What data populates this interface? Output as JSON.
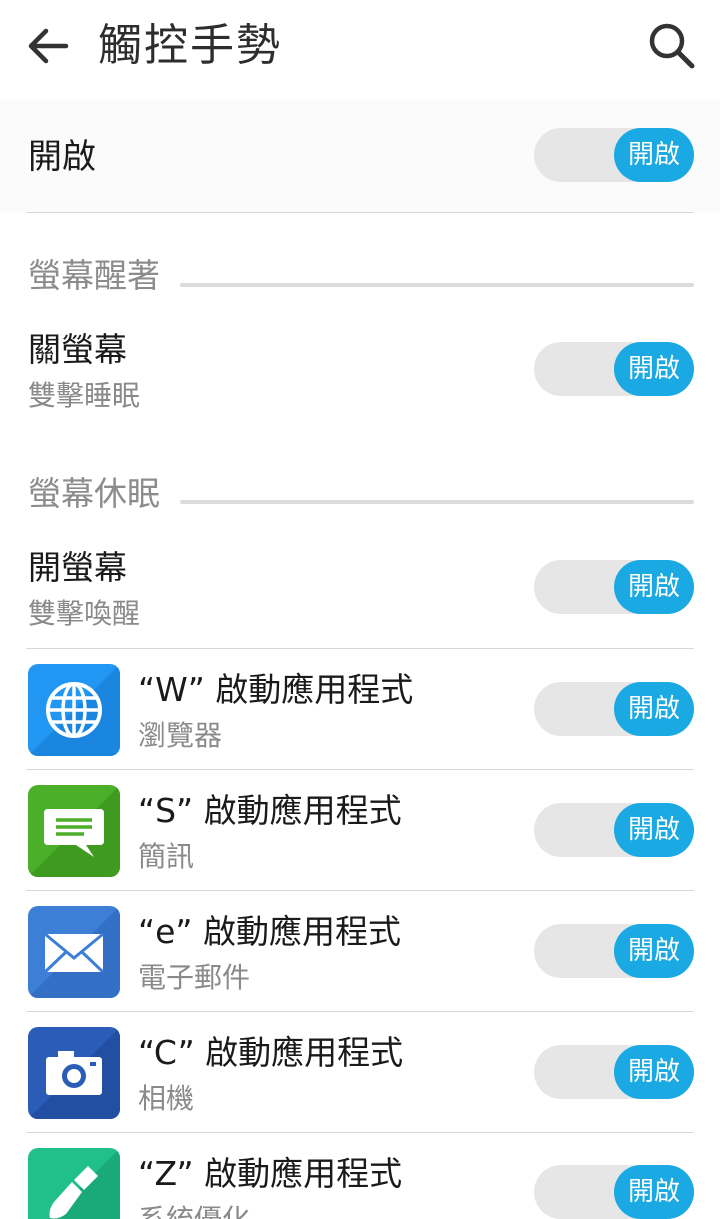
{
  "header": {
    "title": "觸控手勢",
    "back_icon": "arrow-left-icon",
    "search_icon": "search-icon"
  },
  "master": {
    "label": "開啟",
    "toggle_label": "開啟"
  },
  "sections": [
    {
      "header": "螢幕醒著",
      "items": [
        {
          "title": "關螢幕",
          "subtitle": "雙擊睡眠",
          "toggle_label": "開啟"
        }
      ]
    },
    {
      "header": "螢幕休眠",
      "items": [
        {
          "title": "開螢幕",
          "subtitle": "雙擊喚醒",
          "toggle_label": "開啟"
        }
      ]
    }
  ],
  "gestures": [
    {
      "title": "“W” 啟動應用程式",
      "subtitle": "瀏覽器",
      "icon": "browser-globe-icon",
      "toggle_label": "開啟"
    },
    {
      "title": "“S” 啟動應用程式",
      "subtitle": "簡訊",
      "icon": "messages-icon",
      "toggle_label": "開啟"
    },
    {
      "title": "“e” 啟動應用程式",
      "subtitle": "電子郵件",
      "icon": "email-icon",
      "toggle_label": "開啟"
    },
    {
      "title": "“C” 啟動應用程式",
      "subtitle": "相機",
      "icon": "camera-icon",
      "toggle_label": "開啟"
    },
    {
      "title": "“Z” 啟動應用程式",
      "subtitle": "系統優化",
      "icon": "system-optimizer-icon",
      "toggle_label": "開啟"
    }
  ],
  "colors": {
    "accent": "#1ba9e3",
    "track": "#e6e6e6",
    "browser_icon": "#2196f3",
    "messages_icon": "#4caf2a",
    "email_icon": "#3d7fd6",
    "camera_icon": "#2a5cb8",
    "optimizer_icon": "#21c08b"
  }
}
